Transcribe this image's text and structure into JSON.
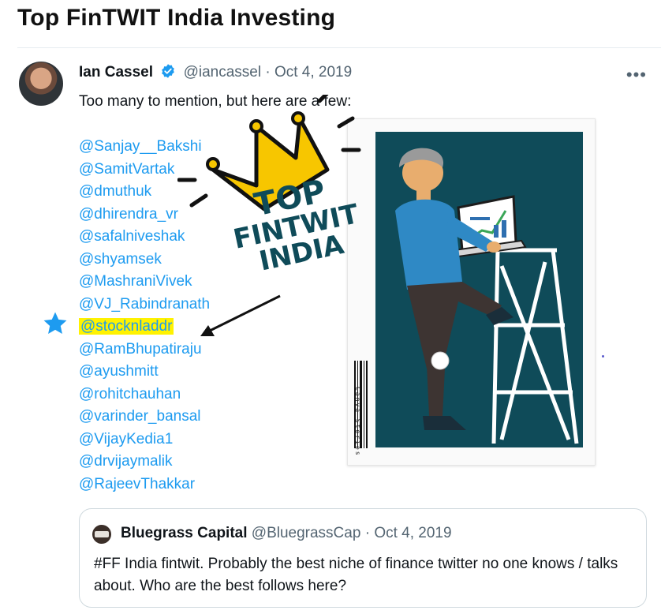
{
  "page": {
    "title": "Top FinTWIT India Investing"
  },
  "tweet": {
    "author_name": "Ian Cassel",
    "handle": "@iancassel",
    "separator": "·",
    "date": "Oct 4, 2019",
    "more": "•••",
    "text": "Too many to mention, but here are a few:",
    "mentions": [
      "@Sanjay__Bakshi",
      "@SamitVartak",
      "@dmuthuk",
      "@dhirendra_vr",
      "@safalniveshak",
      "@shyamsek",
      "@MashraniVivek",
      "@VJ_Rabindranath",
      "@stocknladdr",
      "@RamBhupatiraju",
      "@ayushmitt",
      "@rohitchauhan",
      "@varinder_bansal",
      "@VijayKedia1",
      "@drvijaymalik",
      "@RajeevThakkar"
    ],
    "highlighted_mention": "@stocknladdr"
  },
  "overlay": {
    "stamp_line1": "TOP",
    "stamp_line2": "FINTWIT",
    "stamp_line3": "INDIA",
    "crown_color": "#f7c600",
    "highlight_color": "#fff200",
    "star_color": "#1d9bf0"
  },
  "media": {
    "barcode_text": "Canva Stories",
    "poster_color": "#0f4b59"
  },
  "quoted_tweet": {
    "author_name": "Bluegrass Capital",
    "handle": "@BluegrassCap",
    "separator": "·",
    "date": "Oct 4, 2019",
    "text": "#FF India fintwit. Probably the best niche of finance twitter no one knows / talks about. Who are the best follows here?"
  },
  "colors": {
    "link": "#1d9bf0",
    "secondary_text": "#536471",
    "verified": "#1d9bf0"
  }
}
